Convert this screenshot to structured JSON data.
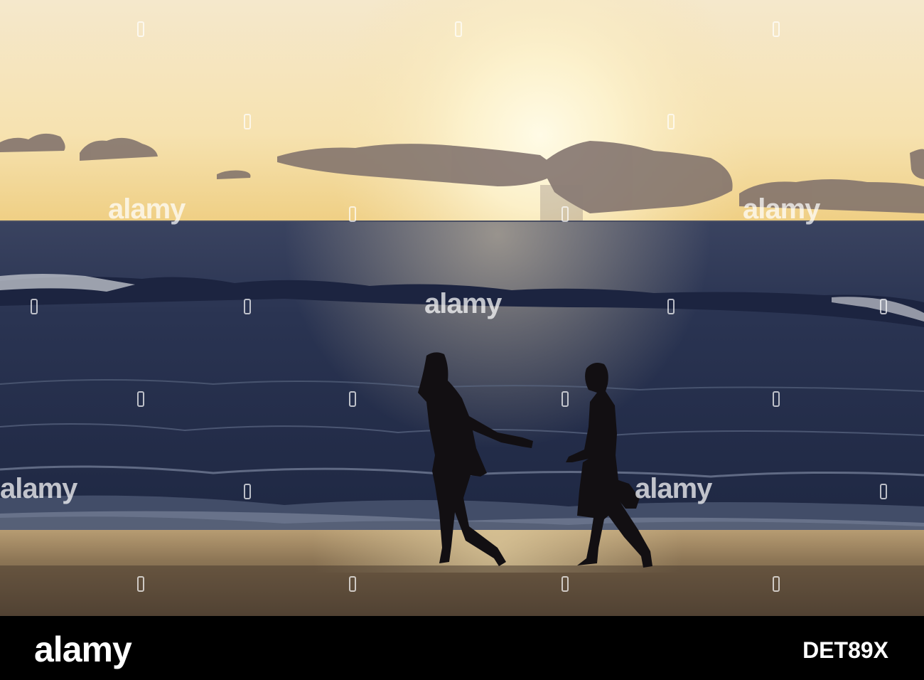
{
  "footer": {
    "brand_logo": "alamy",
    "image_code": "DET89X"
  },
  "watermark": {
    "text": "alamy"
  },
  "colors": {
    "sky_top": "#f7ecd0",
    "sun_glow": "#fff8d8",
    "horizon": "#f3d58a",
    "sea_dark": "#222c4a",
    "sea_mid": "#3c4b6a",
    "sand": "#a48a66",
    "silhouette": "#120f12"
  }
}
